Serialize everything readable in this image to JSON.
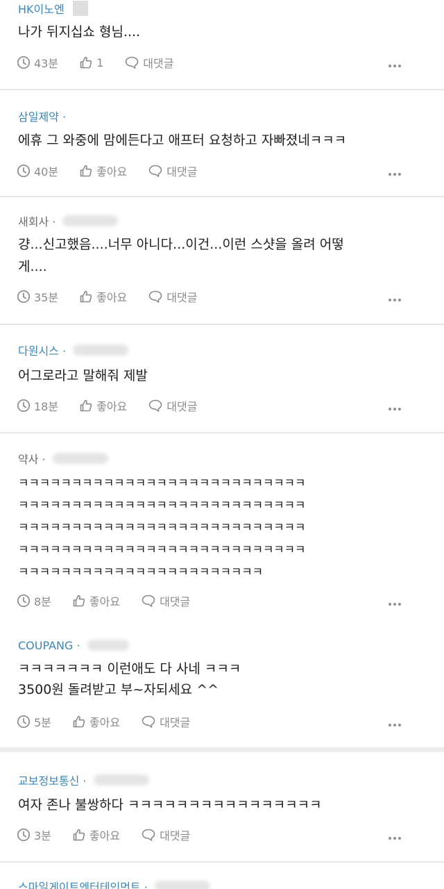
{
  "comments": [
    {
      "author": "HK이노엔",
      "text": "나가 뒤지십쇼 형님....",
      "time": "43분",
      "like_label": "1",
      "reply_label": "대댓글"
    },
    {
      "author": "삼일제약 ·",
      "text": "에휴 그 와중에 맘에든다고 애프터 요청하고 자빠졌네ㅋㅋㅋ",
      "time": "40분",
      "like_label": "좋아요",
      "reply_label": "대댓글"
    },
    {
      "author": "새회사 ·",
      "text": "걍...신고했음....너무 아니다...이건...이런 스샷을 올려 어떻\n게....",
      "time": "35분",
      "like_label": "좋아요",
      "reply_label": "대댓글"
    },
    {
      "author": "다원시스 ·",
      "text": "어그로라고 말해줘 제발",
      "time": "18분",
      "like_label": "좋아요",
      "reply_label": "대댓글"
    },
    {
      "author": "약사 ·",
      "text": "ㅋㅋㅋㅋㅋㅋㅋㅋㅋㅋㅋㅋㅋㅋㅋㅋㅋㅋㅋㅋㅋㅋㅋㅋㅋㅋㅋ\nㅋㅋㅋㅋㅋㅋㅋㅋㅋㅋㅋㅋㅋㅋㅋㅋㅋㅋㅋㅋㅋㅋㅋㅋㅋㅋㅋ\nㅋㅋㅋㅋㅋㅋㅋㅋㅋㅋㅋㅋㅋㅋㅋㅋㅋㅋㅋㅋㅋㅋㅋㅋㅋㅋㅋ\nㅋㅋㅋㅋㅋㅋㅋㅋㅋㅋㅋㅋㅋㅋㅋㅋㅋㅋㅋㅋㅋㅋㅋㅋㅋㅋㅋ\nㅋㅋㅋㅋㅋㅋㅋㅋㅋㅋㅋㅋㅋㅋㅋㅋㅋㅋㅋㅋㅋㅋㅋ",
      "time": "8분",
      "like_label": "좋아요",
      "reply_label": "대댓글"
    },
    {
      "author": "COUPANG ·",
      "text": "ㅋㅋㅋㅋㅋㅋㅋ 이런애도 다 사네 ㅋㅋㅋ\n3500원 돌려받고 부~자되세요 ^^",
      "time": "5분",
      "like_label": "좋아요",
      "reply_label": "대댓글"
    },
    {
      "author": "교보정보통신 ·",
      "text": "여자 존나 불쌍하다 ㅋㅋㅋㅋㅋㅋㅋㅋㅋㅋㅋㅋㅋㅋㅋㅋ",
      "time": "3분",
      "like_label": "좋아요",
      "reply_label": "대댓글"
    },
    {
      "author": "스마일게이트엔터테인먼트 ·"
    }
  ],
  "colors": {
    "company_blue": "#3a87b7",
    "company_gray": "#6d6d6d",
    "meta_gray": "#8a8a8a",
    "divider": "#e6e6e6"
  },
  "icons": {
    "time": "clock-icon",
    "like": "thumbs-up-icon",
    "reply": "speech-bubble-icon",
    "more": "more-dots-icon"
  }
}
